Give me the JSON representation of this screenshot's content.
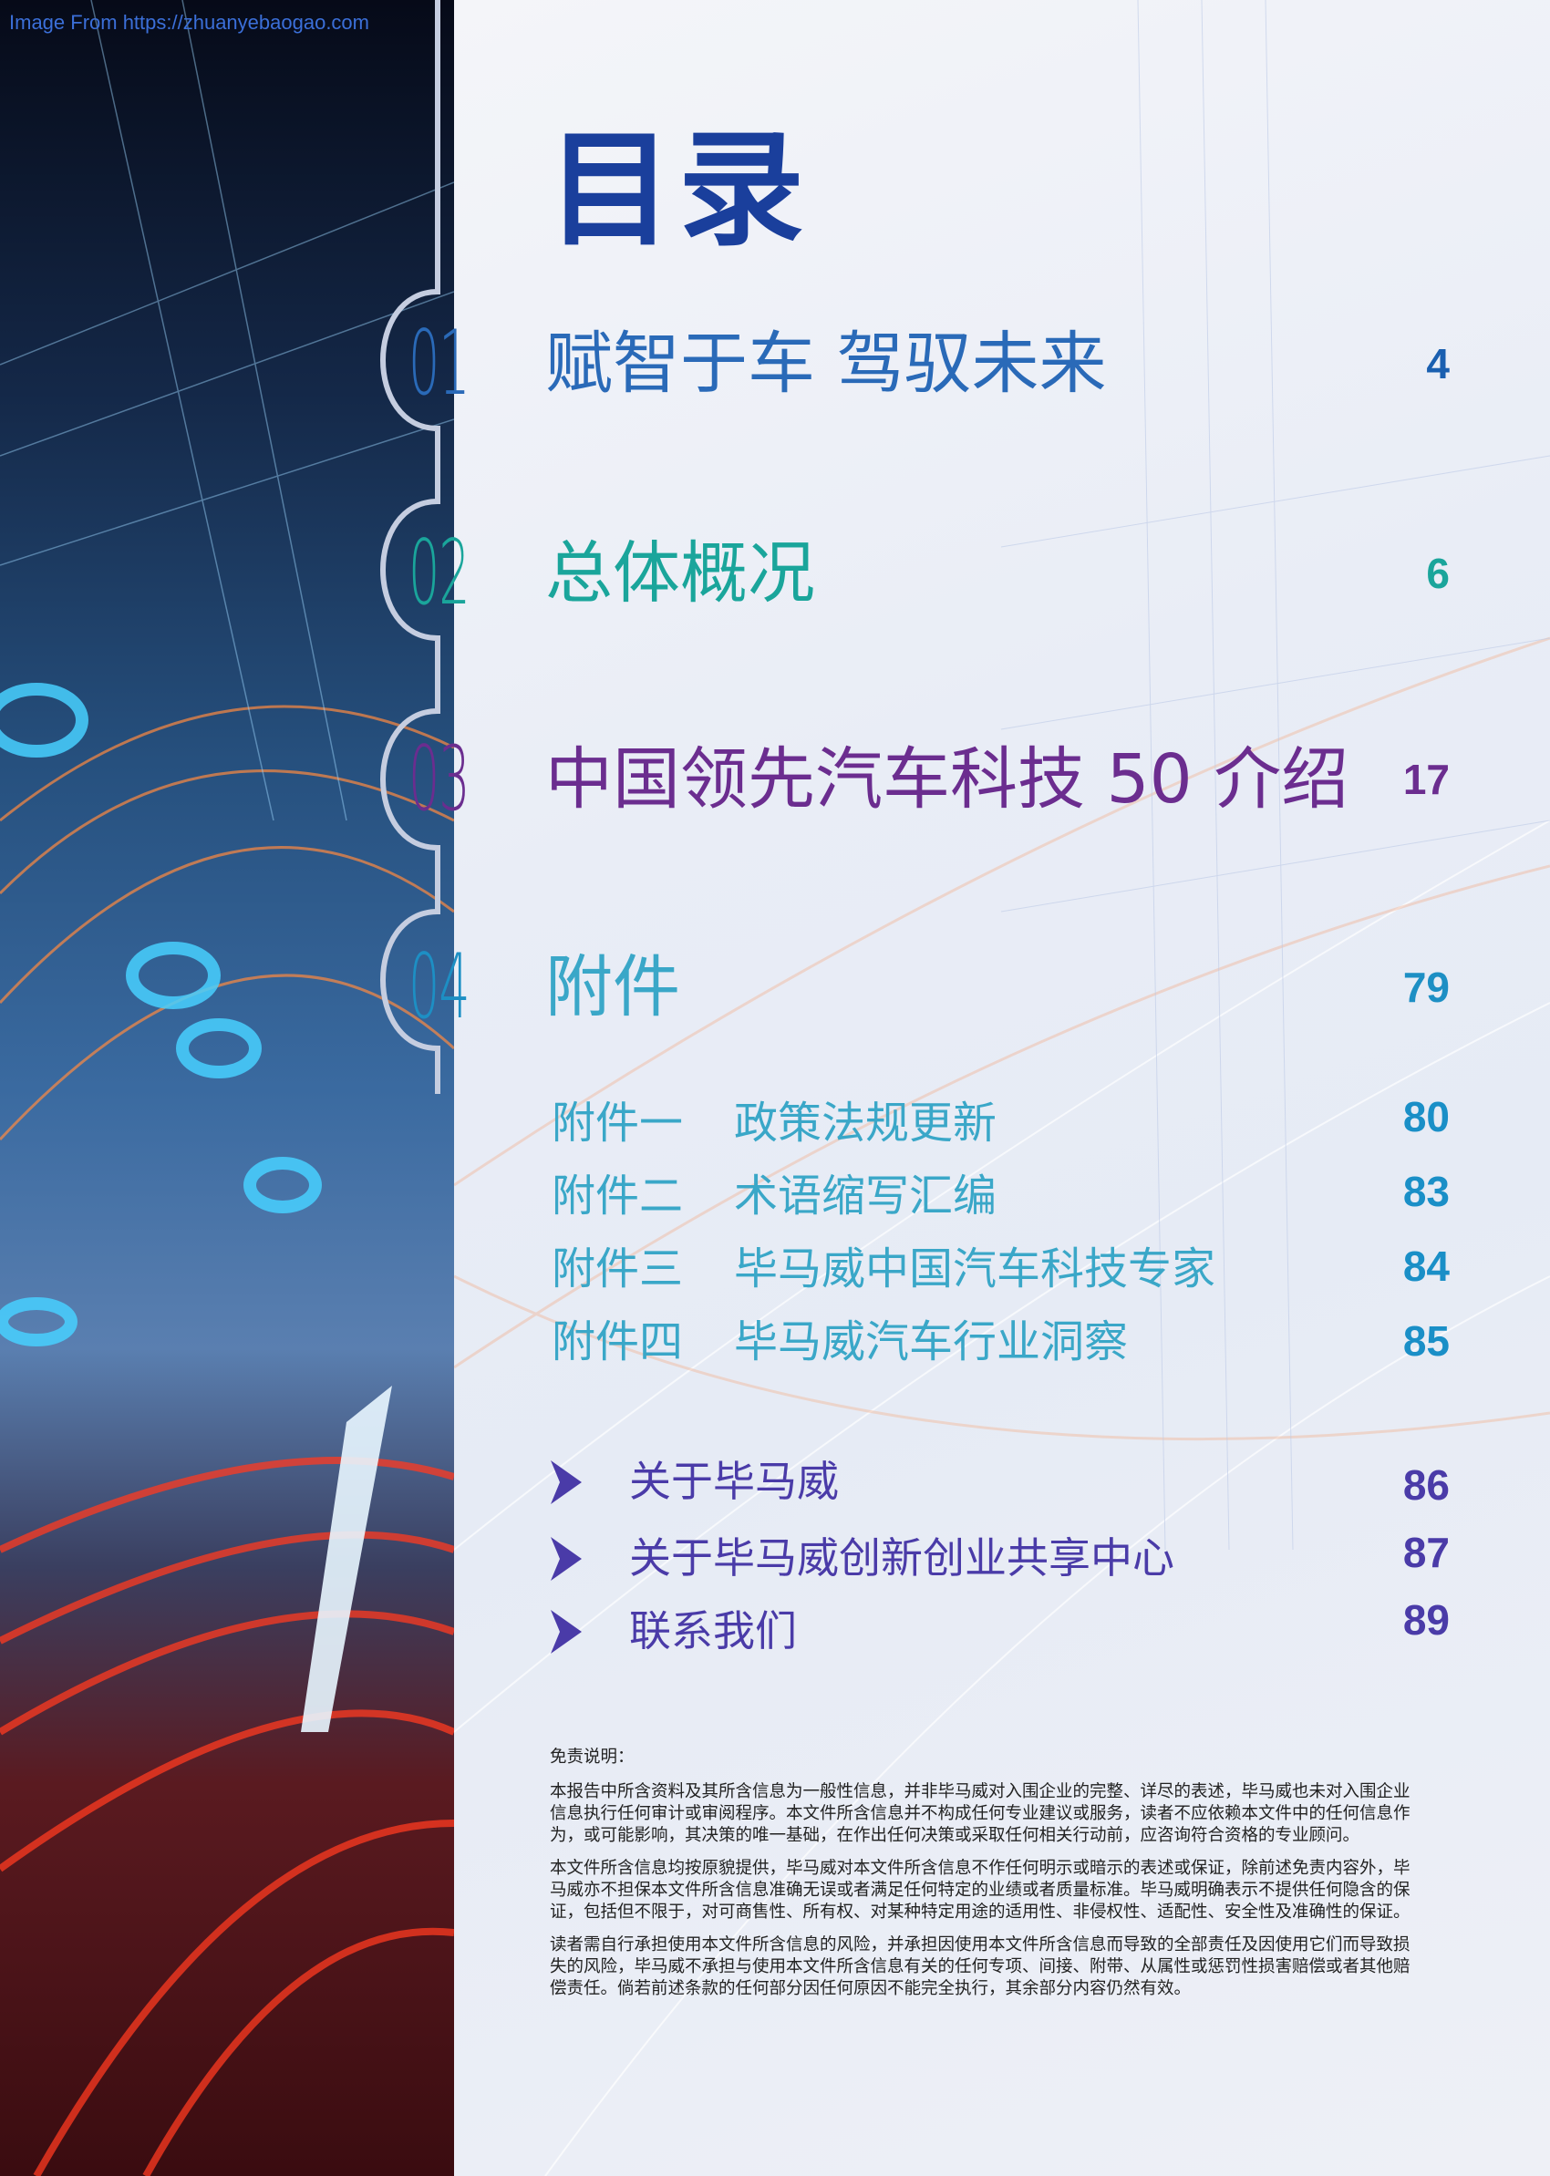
{
  "watermark": "Image From https://zhuanyebaogao.com",
  "title": "目录",
  "sections": [
    {
      "num": "01",
      "title": "赋智于车 驾驭未来",
      "page": "4",
      "color": "#2a6ab8",
      "page_color": "#1a5fb0"
    },
    {
      "num": "02",
      "title": "总体概况",
      "page": "6",
      "color": "#1aa59b",
      "page_color": "#1aa59b"
    },
    {
      "num": "03",
      "title": "中国领先汽车科技 50 介绍",
      "page": "17",
      "color": "#6b2d8f",
      "page_color": "#6b2d8f"
    },
    {
      "num": "04",
      "title": "附件",
      "page": "79",
      "color": "#1d8fc4",
      "page_color": "#1d8fc4"
    }
  ],
  "appendices": [
    {
      "label": "附件一",
      "name": "政策法规更新",
      "page": "80"
    },
    {
      "label": "附件二",
      "name": "术语缩写汇编",
      "page": "83"
    },
    {
      "label": "附件三",
      "name": "毕马威中国汽车科技专家",
      "page": "84"
    },
    {
      "label": "附件四",
      "name": "毕马威汽车行业洞察",
      "page": "85"
    }
  ],
  "about": [
    {
      "label": "关于毕马威",
      "page": "86"
    },
    {
      "label": "关于毕马威创新创业共享中心",
      "page": "87"
    },
    {
      "label": "联系我们",
      "page": "89"
    }
  ],
  "disclaimer": {
    "heading": "免责说明：",
    "paragraphs": [
      "本报告中所含资料及其所含信息为一般性信息，并非毕马威对入围企业的完整、详尽的表述，毕马威也未对入围企业信息执行任何审计或审阅程序。本文件所含信息并不构成任何专业建议或服务，读者不应依赖本文件中的任何信息作为，或可能影响，其决策的唯一基础，在作出任何决策或采取任何相关行动前，应咨询符合资格的专业顾问。",
      "本文件所含信息均按原貌提供，毕马威对本文件所含信息不作任何明示或暗示的表述或保证，除前述免责内容外，毕马威亦不担保本文件所含信息准确无误或者满足任何特定的业绩或者质量标准。毕马威明确表示不提供任何隐含的保证，包括但不限于，对可商售性、所有权、对某种特定用途的适用性、非侵权性、适配性、安全性及准确性的保证。",
      "读者需自行承担使用本文件所含信息的风险，并承担因使用本文件所含信息而导致的全部责任及因使用它们而导致损失的风险，毕马威不承担与使用本文件所含信息有关的任何专项、间接、附带、从属性或惩罚性损害赔偿或者其他赔偿责任。倘若前述条款的任何部分因任何原因不能完全执行，其余部分内容仍然有效。"
    ]
  },
  "colors": {
    "title": "#1a3f9c",
    "appendix": "#3aa7c8",
    "about": "#4a3ba8"
  }
}
